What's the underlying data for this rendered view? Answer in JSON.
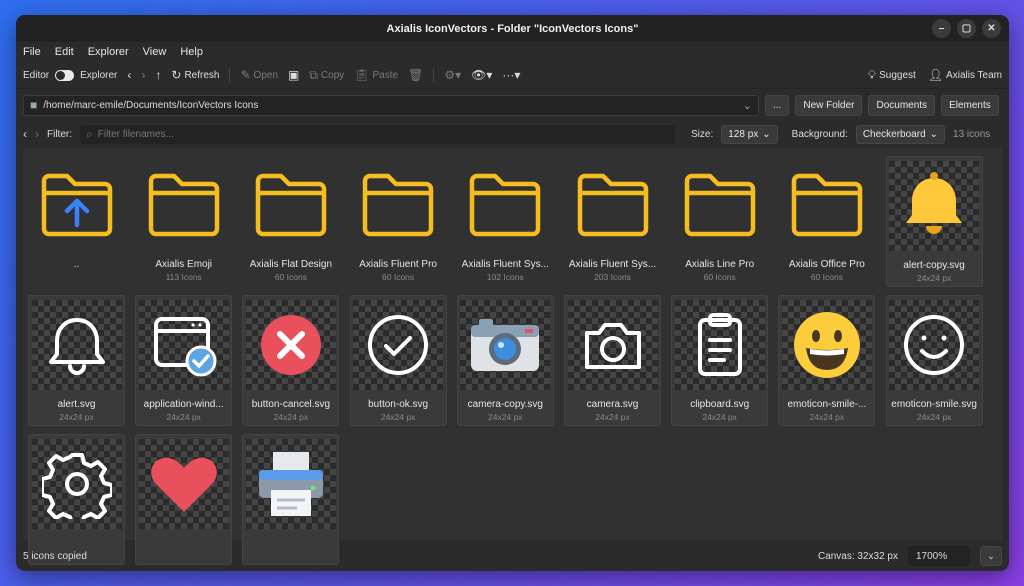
{
  "window": {
    "title": "Axialis IconVectors - Folder \"IconVectors Icons\""
  },
  "menu": [
    "File",
    "Edit",
    "Explorer",
    "View",
    "Help"
  ],
  "toolbar": {
    "editor_label": "Editor",
    "explorer_label": "Explorer",
    "refresh_label": "Refresh",
    "open_label": "Open",
    "copy_label": "Copy",
    "paste_label": "Paste",
    "suggest_label": "Suggest",
    "team_label": "Axialis Team"
  },
  "path": {
    "value": "/home/marc-emile/Documents/IconVectors Icons",
    "more_label": "...",
    "new_folder_label": "New Folder",
    "documents_label": "Documents",
    "elements_label": "Elements"
  },
  "filter": {
    "label": "Filter:",
    "placeholder": "Filter filenames...",
    "size_label": "Size:",
    "size_value": "128 px",
    "background_label": "Background:",
    "background_value": "Checkerboard",
    "count": "13 icons"
  },
  "items": [
    {
      "name": "..",
      "sub": "",
      "icon": "folder-up-icon"
    },
    {
      "name": "Axialis Emoji",
      "sub": "113 Icons",
      "icon": "folder-icon"
    },
    {
      "name": "Axialis Flat Design",
      "sub": "60 Icons",
      "icon": "folder-icon"
    },
    {
      "name": "Axialis Fluent Pro",
      "sub": "60 Icons",
      "icon": "folder-icon"
    },
    {
      "name": "Axialis Fluent Sys...",
      "sub": "102 Icons",
      "icon": "folder-icon"
    },
    {
      "name": "Axialis Fluent Sys...",
      "sub": "203 Icons",
      "icon": "folder-icon"
    },
    {
      "name": "Axialis Line Pro",
      "sub": "60 Icons",
      "icon": "folder-icon"
    },
    {
      "name": "Axialis Office Pro",
      "sub": "60 Icons",
      "icon": "folder-icon"
    },
    {
      "name": "alert-copy.svg",
      "sub": "24x24 px",
      "icon": "bell-filled-icon"
    },
    {
      "name": "alert.svg",
      "sub": "24x24 px",
      "icon": "bell-outline-icon"
    },
    {
      "name": "application-wind...",
      "sub": "24x24 px",
      "icon": "application-window-icon"
    },
    {
      "name": "button-cancel.svg",
      "sub": "24x24 px",
      "icon": "cancel-icon"
    },
    {
      "name": "button-ok.svg",
      "sub": "24x24 px",
      "icon": "check-circle-icon"
    },
    {
      "name": "camera-copy.svg",
      "sub": "24x24 px",
      "icon": "camera-color-icon"
    },
    {
      "name": "camera.svg",
      "sub": "24x24 px",
      "icon": "camera-outline-icon"
    },
    {
      "name": "clipboard.svg",
      "sub": "24x24 px",
      "icon": "clipboard-icon"
    },
    {
      "name": "emoticon-smile-...",
      "sub": "24x24 px",
      "icon": "emoji-smile-color-icon"
    },
    {
      "name": "emoticon-smile.svg",
      "sub": "24x24 px",
      "icon": "smile-outline-icon"
    },
    {
      "name": "",
      "sub": "",
      "icon": "gear-icon"
    },
    {
      "name": "",
      "sub": "",
      "icon": "heart-icon"
    },
    {
      "name": "",
      "sub": "",
      "icon": "printer-icon"
    }
  ],
  "status": {
    "left": "5 icons copied",
    "canvas": "Canvas: 32x32 px",
    "zoom": "1700%"
  },
  "colors": {
    "folder": "#f5bd1f",
    "accent_blue": "#3b82f6",
    "red": "#e8505b"
  }
}
